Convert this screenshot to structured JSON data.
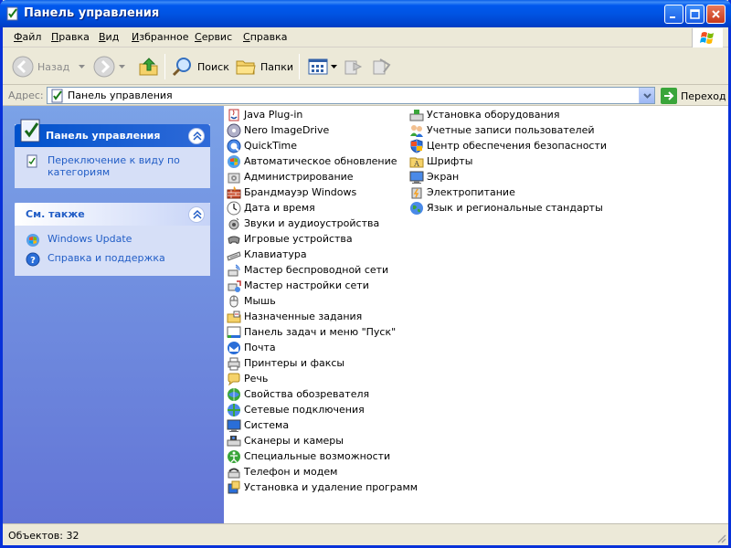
{
  "window": {
    "title": "Панель управления"
  },
  "menu": [
    "Файл",
    "Правка",
    "Вид",
    "Избранное",
    "Сервис",
    "Справка"
  ],
  "toolbar": {
    "back": "Назад",
    "search": "Поиск",
    "folders": "Папки"
  },
  "address": {
    "label": "Адрес:",
    "value": "Панель управления",
    "go": "Переход"
  },
  "sidebar": {
    "control_panel": {
      "title": "Панель управления",
      "switch_link": "Переключение к виду по категориям"
    },
    "see_also": {
      "title": "См. также",
      "links": [
        "Windows Update",
        "Справка и поддержка"
      ]
    }
  },
  "items_col1": [
    "Java Plug-in",
    "Nero ImageDrive",
    "QuickTime",
    "Автоматическое обновление",
    "Администрирование",
    "Брандмауэр Windows",
    "Дата и время",
    "Звуки и аудиоустройства",
    "Игровые устройства",
    "Клавиатура",
    "Мастер беспроводной сети",
    "Мастер настройки сети",
    "Мышь",
    "Назначенные задания",
    "Панель задач и меню \"Пуск\"",
    "Почта",
    "Принтеры и факсы",
    "Речь",
    "Свойства обозревателя",
    "Сетевые подключения",
    "Система",
    "Сканеры и камеры",
    "Специальные возможности",
    "Телефон и модем",
    "Установка и удаление программ"
  ],
  "items_col2": [
    "Установка оборудования",
    "Учетные записи пользователей",
    "Центр обеспечения безопасности",
    "Шрифты",
    "Экран",
    "Электропитание",
    "Язык и региональные стандарты"
  ],
  "icons_col1": [
    "java-icon",
    "nero-icon",
    "quicktime-icon",
    "auto-update-icon",
    "admin-tools-icon",
    "firewall-icon",
    "date-time-icon",
    "sound-icon",
    "game-controller-icon",
    "keyboard-icon",
    "wireless-wizard-icon",
    "network-wizard-icon",
    "mouse-icon",
    "scheduled-tasks-icon",
    "taskbar-icon",
    "mail-icon",
    "printers-icon",
    "speech-icon",
    "internet-options-icon",
    "network-connections-icon",
    "system-icon",
    "scanner-icon",
    "accessibility-icon",
    "phone-modem-icon",
    "add-remove-programs-icon"
  ],
  "icons_col2": [
    "add-hardware-icon",
    "user-accounts-icon",
    "security-center-icon",
    "fonts-folder-icon",
    "display-icon",
    "power-icon",
    "regional-icon"
  ],
  "status": {
    "text": "Объектов: 32"
  },
  "colors": {
    "accent": "#0054e3",
    "link": "#215dc6",
    "sidebar_top": "#7ba2e7",
    "sidebar_bottom": "#6375d6"
  }
}
